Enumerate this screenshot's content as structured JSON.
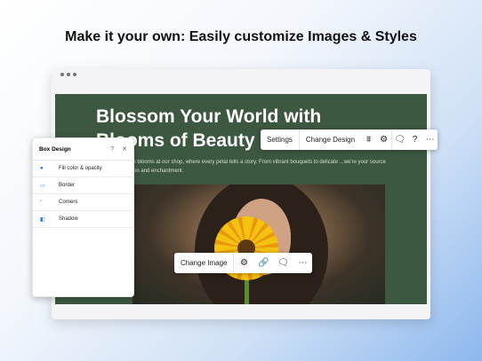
{
  "headline": "Make it your own: Easily customize Images & Styles",
  "site": {
    "title_line1": "Blossom Your World with",
    "title_line2": "Blooms of Beauty",
    "body": "...beauty of fresh blooms at our shop, where every petal tells a story. From vibrant bouquets to delicate ...we're your source of floral inspiration and enchantment."
  },
  "text_toolbar": {
    "settings": "Settings",
    "change_design": "Change Design",
    "icons": [
      "animation-icon",
      "gear-icon",
      "comment-icon",
      "help-icon",
      "more-icon"
    ]
  },
  "image_toolbar": {
    "change_image": "Change Image",
    "icons": [
      "gear-icon",
      "link-icon",
      "comment-icon",
      "more-icon"
    ]
  },
  "box_design": {
    "title": "Box Design",
    "help": "?",
    "close": "✕",
    "items": [
      {
        "label": "Fill color & opacity",
        "icon": "fill-icon"
      },
      {
        "label": "Border",
        "icon": "border-icon"
      },
      {
        "label": "Corners",
        "icon": "corners-icon"
      },
      {
        "label": "Shadow",
        "icon": "shadow-icon"
      }
    ]
  },
  "colors": {
    "accent": "#116dff",
    "site_bg": "#3c5840"
  }
}
